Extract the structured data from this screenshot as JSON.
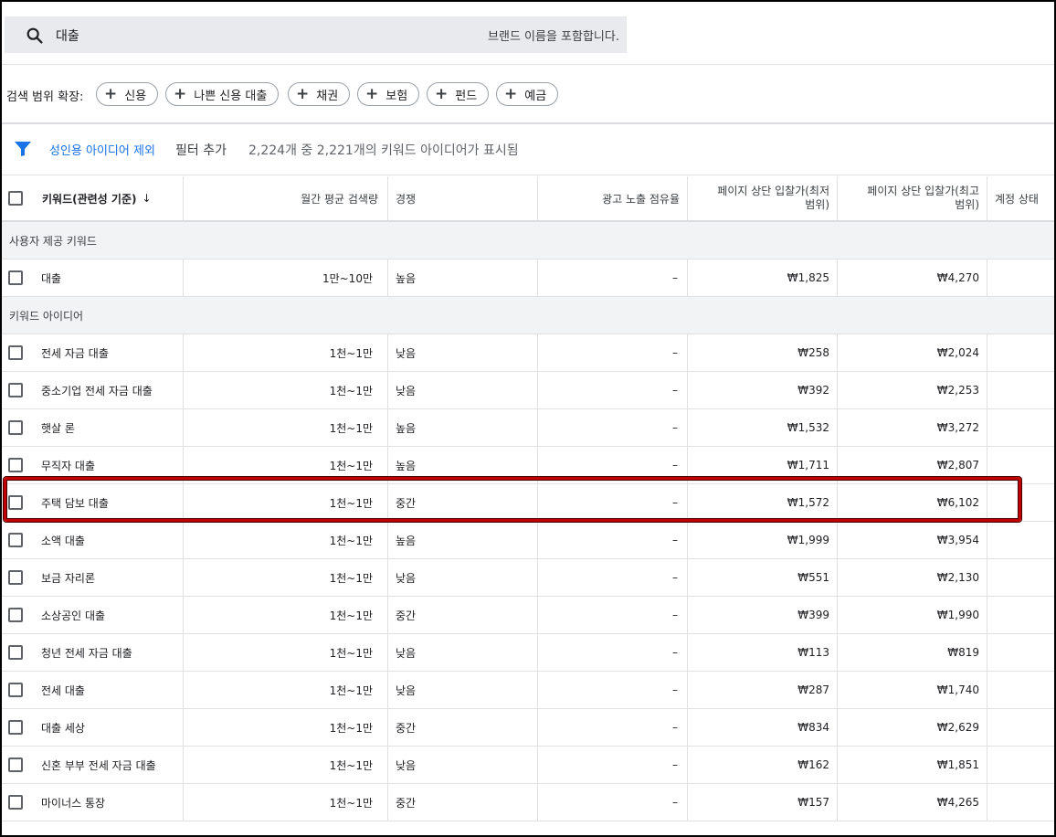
{
  "search": {
    "query": "대출",
    "hint": "브랜드 이름을 포함합니다."
  },
  "expand": {
    "label": "검색 범위 확장:",
    "chips": [
      "신용",
      "나쁜 신용 대출",
      "채권",
      "보험",
      "펀드",
      "예금"
    ]
  },
  "filter": {
    "exclude_label": "성인용 아이디어 제외",
    "add_label": "필터 추가",
    "count_text": "2,224개 중 2,221개의 키워드 아이디어가 표시됨"
  },
  "columns": {
    "keyword": "키워드(관련성 기준)",
    "volume": "월간 평균 검색량",
    "competition": "경쟁",
    "impression_share": "광고 노출 점유율",
    "bid_low_1": "페이지 상단 입찰가(최저",
    "bid_low_2": "범위)",
    "bid_high_1": "페이지 상단 입찰가(최고",
    "bid_high_2": "범위)",
    "status": "계정 상태"
  },
  "sections": {
    "user_provided": "사용자 제공 키워드",
    "ideas": "키워드 아이디어"
  },
  "provided_rows": [
    {
      "keyword": "대출",
      "volume": "1만~10만",
      "competition": "높음",
      "share": "–",
      "low": "₩1,825",
      "high": "₩4,270"
    }
  ],
  "idea_rows": [
    {
      "keyword": "전세 자금 대출",
      "volume": "1천~1만",
      "competition": "낮음",
      "share": "–",
      "low": "₩258",
      "high": "₩2,024"
    },
    {
      "keyword": "중소기업 전세 자금 대출",
      "volume": "1천~1만",
      "competition": "낮음",
      "share": "–",
      "low": "₩392",
      "high": "₩2,253"
    },
    {
      "keyword": "햇살 론",
      "volume": "1천~1만",
      "competition": "높음",
      "share": "–",
      "low": "₩1,532",
      "high": "₩3,272"
    },
    {
      "keyword": "무직자 대출",
      "volume": "1천~1만",
      "competition": "높음",
      "share": "–",
      "low": "₩1,711",
      "high": "₩2,807"
    },
    {
      "keyword": "주택 담보 대출",
      "volume": "1천~1만",
      "competition": "중간",
      "share": "–",
      "low": "₩1,572",
      "high": "₩6,102"
    },
    {
      "keyword": "소액 대출",
      "volume": "1천~1만",
      "competition": "높음",
      "share": "–",
      "low": "₩1,999",
      "high": "₩3,954"
    },
    {
      "keyword": "보금 자리론",
      "volume": "1천~1만",
      "competition": "낮음",
      "share": "–",
      "low": "₩551",
      "high": "₩2,130"
    },
    {
      "keyword": "소상공인 대출",
      "volume": "1천~1만",
      "competition": "중간",
      "share": "–",
      "low": "₩399",
      "high": "₩1,990"
    },
    {
      "keyword": "청년 전세 자금 대출",
      "volume": "1천~1만",
      "competition": "낮음",
      "share": "–",
      "low": "₩113",
      "high": "₩819"
    },
    {
      "keyword": "전세 대출",
      "volume": "1천~1만",
      "competition": "낮음",
      "share": "–",
      "low": "₩287",
      "high": "₩1,740"
    },
    {
      "keyword": "대출 세상",
      "volume": "1천~1만",
      "competition": "중간",
      "share": "–",
      "low": "₩834",
      "high": "₩2,629"
    },
    {
      "keyword": "신혼 부부 전세 자금 대출",
      "volume": "1천~1만",
      "competition": "낮음",
      "share": "–",
      "low": "₩162",
      "high": "₩1,851"
    },
    {
      "keyword": "마이너스 통장",
      "volume": "1천~1만",
      "competition": "중간",
      "share": "–",
      "low": "₩157",
      "high": "₩4,265"
    }
  ],
  "colors": {
    "accent": "#1a73e8",
    "highlight": "#c00000"
  }
}
